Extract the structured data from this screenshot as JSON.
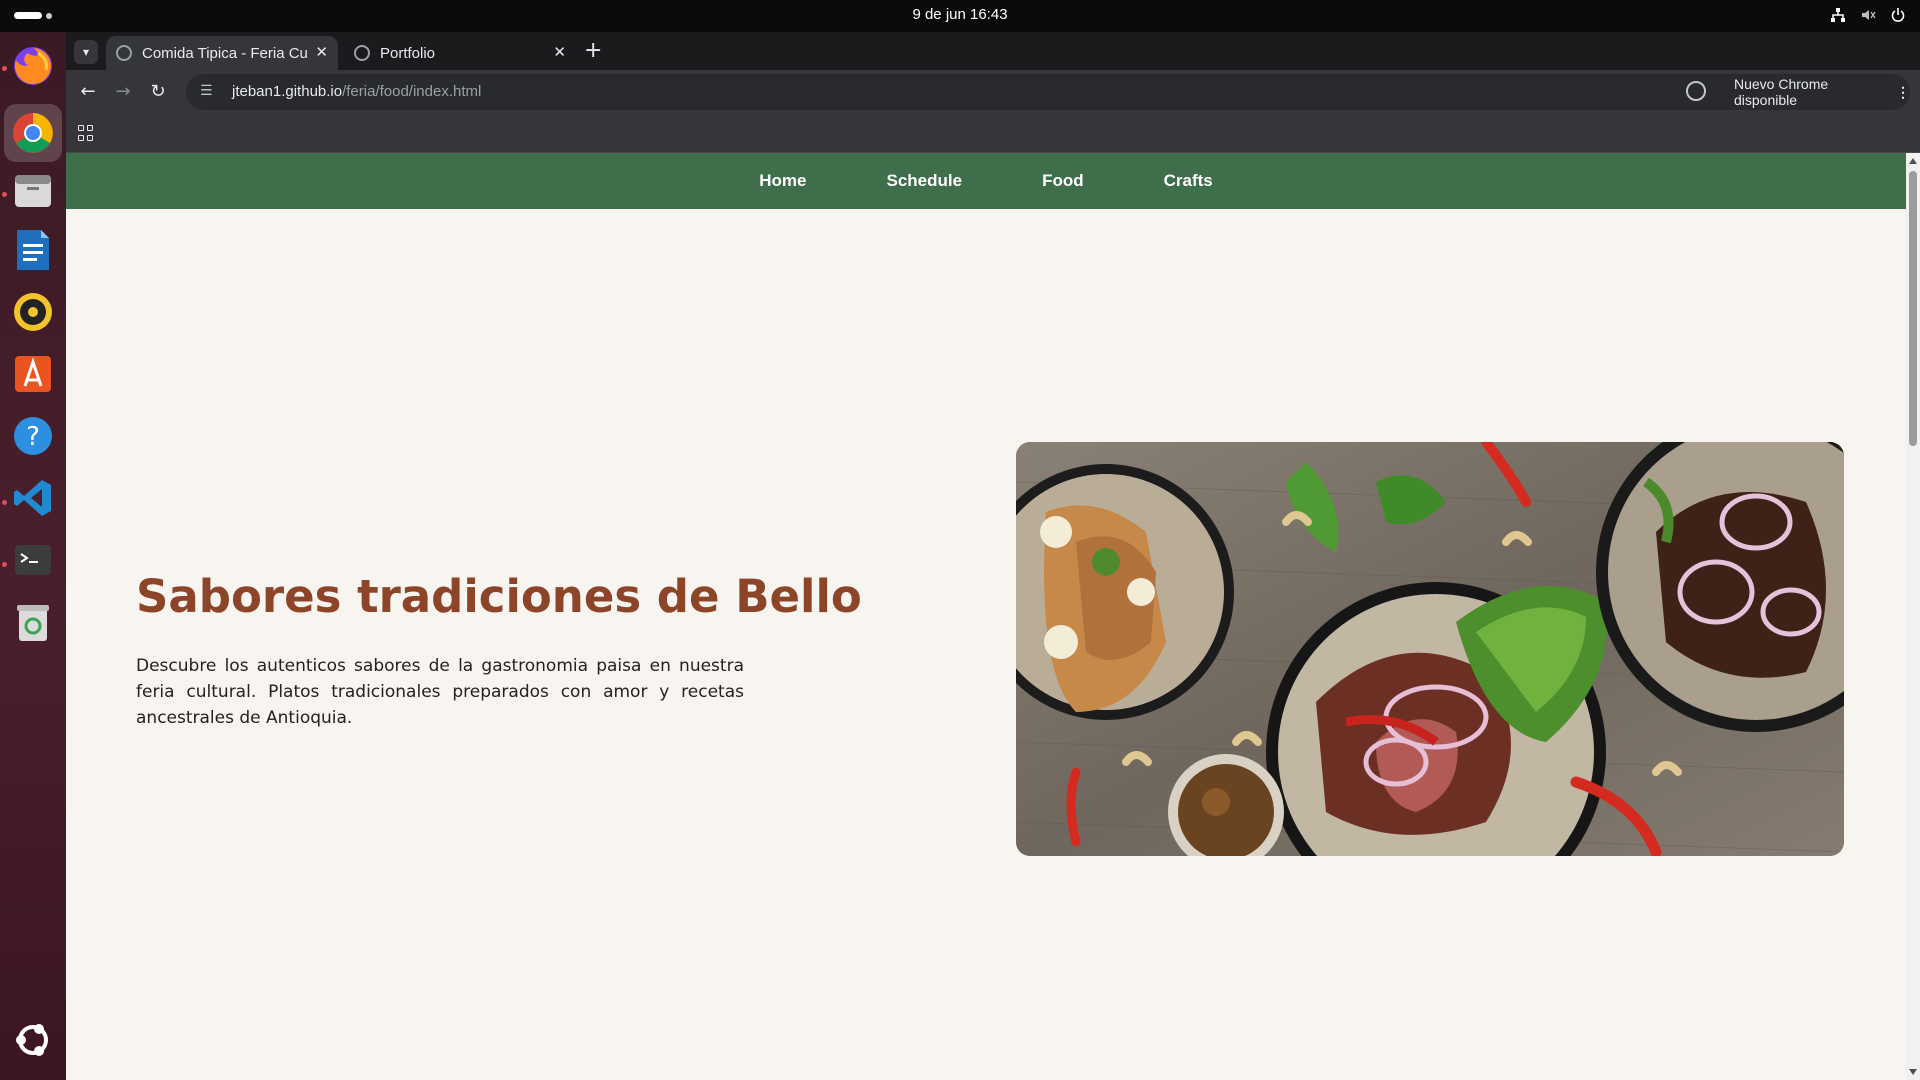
{
  "system": {
    "clock": "9 de jun  16:43"
  },
  "dock": {
    "apps": [
      "firefox-icon",
      "chrome-icon",
      "files-icon",
      "writer-icon",
      "rhythmbox-icon",
      "app-center-icon",
      "help-icon",
      "vscode-icon",
      "terminal-icon",
      "trash-icon",
      "ubuntu-menu-icon"
    ]
  },
  "browser": {
    "tabs": [
      {
        "title": "Comida Tipica - Feria Cultural"
      },
      {
        "title": "Portfolio"
      }
    ],
    "url_host": "jteban1.github.io",
    "url_path": "/feria/food/index.html",
    "update_label": "Nuevo Chrome disponible"
  },
  "site": {
    "nav": [
      "Home",
      "Schedule",
      "Food",
      "Crafts"
    ],
    "hero": {
      "title": "Sabores tradiciones de Bello",
      "text": "Descubre los autenticos sabores de la gastronomia paisa en nuestra feria cultural. Platos tradicionales preparados con amor y recetas ancestrales de Antioquia."
    }
  },
  "colors": {
    "nav_bg": "#3f6e4b",
    "title": "#8c4528",
    "page_bg": "#f8f5f0"
  }
}
